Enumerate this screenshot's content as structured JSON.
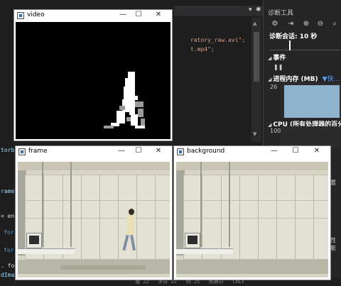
{
  "ide": {
    "code_line_1": "ratory_raw.avi\";",
    "code_line_2": "t.mp4\";",
    "left_fragments": [
      "torb",
      "rame",
      "< en",
      "for",
      "for",
      ". fo",
      "dIma"
    ],
    "status_bar": "彟 22   字符 22   列 25   制表符   CRLF"
  },
  "diagnostics": {
    "title": "诊断工具",
    "session_label": "诊断会话: 10 秒",
    "events_label": "事件",
    "process_memory_label": "进程内存 (MB)",
    "memory_legend": "▼快...",
    "memory_axis_max": "26",
    "cpu_label": "CPU (所有处理器的百分比)",
    "cpu_axis_max": "100",
    "side_fragment_1": "置",
    "side_fragment_2": "性能"
  },
  "windows": {
    "video": {
      "title": "video"
    },
    "frame": {
      "title": "frame"
    },
    "background": {
      "title": "background"
    }
  },
  "window_controls": {
    "minimize": "—",
    "maximize": "☐",
    "close": "✕"
  },
  "colors": {
    "ide_bg": "#1e1e1e",
    "memory_fill": "#8eb4cd",
    "accent_blue": "#5ba0e8"
  }
}
